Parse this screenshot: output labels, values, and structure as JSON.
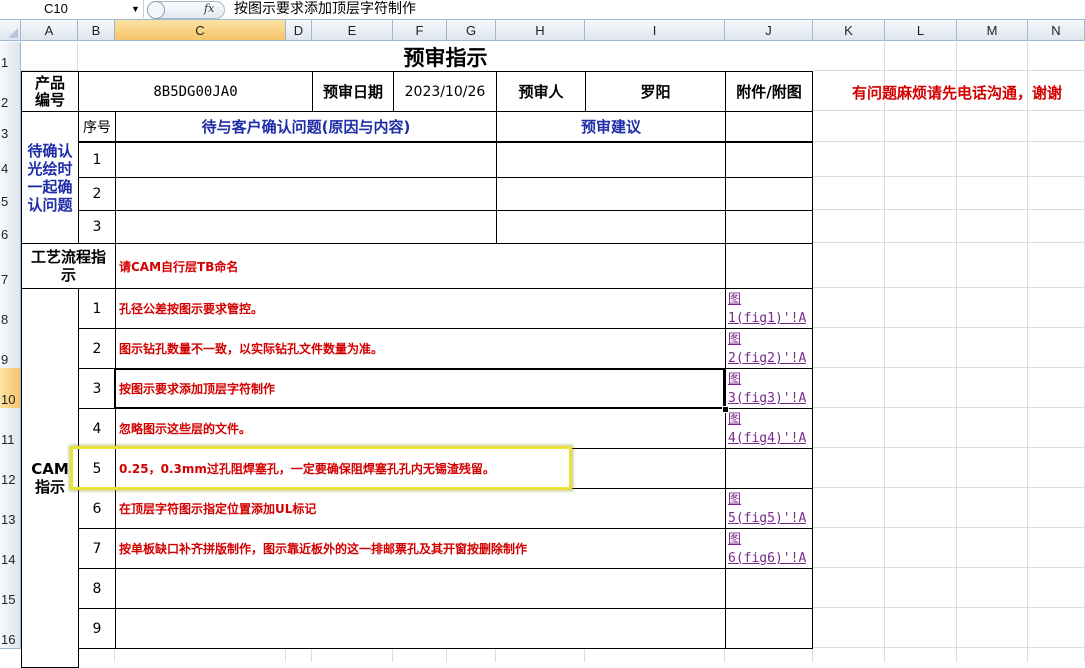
{
  "formula_bar": {
    "name_box": "C10",
    "fx_label": "fx",
    "formula": "按图示要求添加顶层字符制作"
  },
  "columns": [
    "A",
    "B",
    "C",
    "D",
    "E",
    "F",
    "G",
    "H",
    "I",
    "J",
    "K",
    "L",
    "M",
    "N"
  ],
  "rows": [
    "1",
    "2",
    "3",
    "4",
    "5",
    "6",
    "7",
    "8",
    "9",
    "10",
    "11",
    "12",
    "13",
    "14",
    "15",
    "16"
  ],
  "sheet": {
    "title": "预审指示",
    "product_label": "产品编号",
    "product_no": "8B5DG00JA0",
    "review_date_label": "预审日期",
    "review_date": "2023/10/26",
    "reviewer_label": "预审人",
    "reviewer": "罗阳",
    "attachment_label": "附件/附图",
    "notice": "有问题麻烦请先电话沟通，谢谢",
    "seq_label": "序号",
    "question_header": "待与客户确认问题(原因与内容)",
    "suggestion_header": "预审建议",
    "confirm_label": "待确认光绘时一起确认问题",
    "confirm_rows": [
      "1",
      "2",
      "3"
    ],
    "process_label": "工艺流程指示",
    "process_text": "请CAM自行层TB命名",
    "cam_label": "CAM指示",
    "cam_items": [
      {
        "no": "1",
        "text": "孔径公差按图示要求管控。",
        "link1": "图",
        "link2": "1(fig1)'!A"
      },
      {
        "no": "2",
        "text": "图示钻孔数量不一致，以实际钻孔文件数量为准。",
        "link1": "图",
        "link2": "2(fig2)'!A"
      },
      {
        "no": "3",
        "text": "按图示要求添加顶层字符制作",
        "link1": "图",
        "link2": "3(fig3)'!A"
      },
      {
        "no": "4",
        "text": "忽略图示这些层的文件。",
        "link1": "图",
        "link2": "4(fig4)'!A"
      },
      {
        "no": "5",
        "text": "0.25，0.3mm过孔阻焊塞孔，一定要确保阻焊塞孔孔内无锡渣残留。",
        "link1": "",
        "link2": ""
      },
      {
        "no": "6",
        "text": "在顶层字符图示指定位置添加UL标记",
        "link1": "图",
        "link2": "5(fig5)'!A"
      },
      {
        "no": "7",
        "text": "按单板缺口补齐拼版制作，图示靠近板外的这一排邮票孔及其开窗按删除制作",
        "link1": "图",
        "link2": "6(fig6)'!A"
      },
      {
        "no": "8",
        "text": "",
        "link1": "",
        "link2": ""
      },
      {
        "no": "9",
        "text": "",
        "link1": "",
        "link2": ""
      }
    ]
  }
}
